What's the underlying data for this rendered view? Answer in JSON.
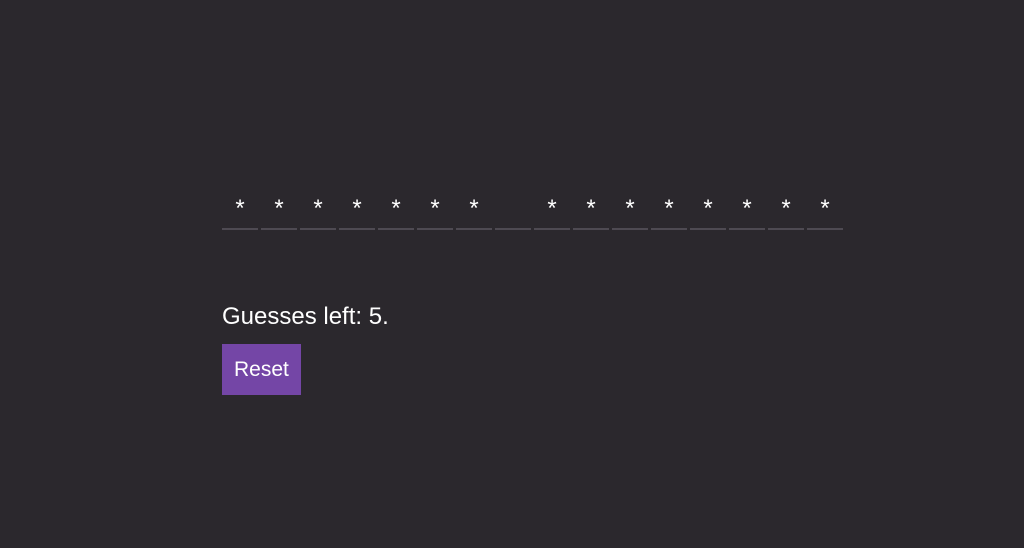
{
  "puzzle": {
    "slots": [
      "*",
      "*",
      "*",
      "*",
      "*",
      "*",
      "*",
      "",
      "*",
      "*",
      "*",
      "*",
      "*",
      "*",
      "*",
      "*"
    ]
  },
  "status": {
    "text": "Guesses left: 5."
  },
  "controls": {
    "reset_label": "Reset"
  },
  "colors": {
    "background": "#2b282d",
    "accent": "#7446a6",
    "slot_underline": "#4e4a52",
    "text": "#ffffff"
  }
}
